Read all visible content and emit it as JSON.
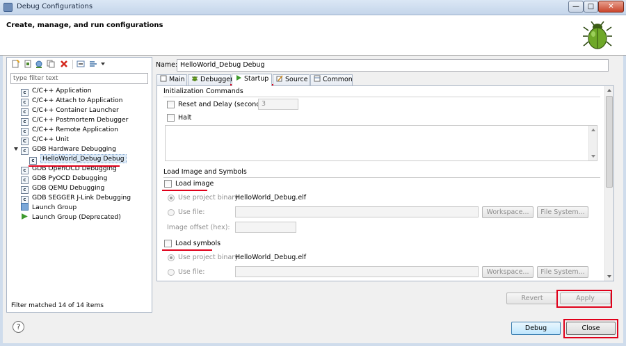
{
  "window": {
    "title": "Debug Configurations",
    "min": "—",
    "max": "□",
    "close": "✕"
  },
  "header": {
    "title": "Create, manage, and run configurations"
  },
  "left": {
    "filter_placeholder": "type filter text",
    "tree": [
      {
        "label": "C/C++ Application",
        "icon": "C",
        "indent": 1
      },
      {
        "label": "C/C++ Attach to Application",
        "icon": "C",
        "indent": 1
      },
      {
        "label": "C/C++ Container Launcher",
        "icon": "C",
        "indent": 1
      },
      {
        "label": "C/C++ Postmortem Debugger",
        "icon": "C",
        "indent": 1
      },
      {
        "label": "C/C++ Remote Application",
        "icon": "C",
        "indent": 1
      },
      {
        "label": "C/C++ Unit",
        "icon": "Cu",
        "indent": 1
      },
      {
        "label": "GDB Hardware Debugging",
        "icon": "C",
        "indent": 1,
        "expanded": true
      },
      {
        "label": "HelloWorld_Debug Debug",
        "icon": "C",
        "indent": 2,
        "selected": true
      },
      {
        "label": "GDB OpenOCD Debugging",
        "icon": "C",
        "indent": 1
      },
      {
        "label": "GDB PyOCD Debugging",
        "icon": "C",
        "indent": 1
      },
      {
        "label": "GDB QEMU Debugging",
        "icon": "C",
        "indent": 1
      },
      {
        "label": "GDB SEGGER J-Link Debugging",
        "icon": "C",
        "indent": 1
      },
      {
        "label": "Launch Group",
        "icon": "launch",
        "indent": 1
      },
      {
        "label": "Launch Group (Deprecated)",
        "icon": "play",
        "indent": 1
      }
    ],
    "filter_status": "Filter matched 14 of 14 items"
  },
  "right": {
    "name_label": "Name:",
    "name_value": "HelloWorld_Debug Debug",
    "tabs": [
      "Main",
      "Debugger",
      "Startup",
      "Source",
      "Common"
    ],
    "active_tab": "Startup",
    "init": {
      "group_label": "Initialization Commands",
      "reset_label": "Reset and Delay (seconds):",
      "reset_value": "3",
      "halt_label": "Halt"
    },
    "load": {
      "group_label": "Load Image and Symbols",
      "load_image_label": "Load image",
      "use_project_binary_label": "Use project binary:",
      "project_binary": "HelloWorld_Debug.elf",
      "use_file_label": "Use file:",
      "workspace_label": "Workspace...",
      "filesystem_label": "File System...",
      "image_offset_label": "Image offset (hex):",
      "load_symbols_label": "Load symbols",
      "symbols_project_binary": "HelloWorld_Debug.elf"
    },
    "revert_label": "Revert",
    "apply_label": "Apply"
  },
  "footer": {
    "help": "?",
    "debug_label": "Debug",
    "close_label": "Close"
  },
  "colors": {
    "annotation": "#e0001a",
    "accent": "#3c7fb1"
  }
}
